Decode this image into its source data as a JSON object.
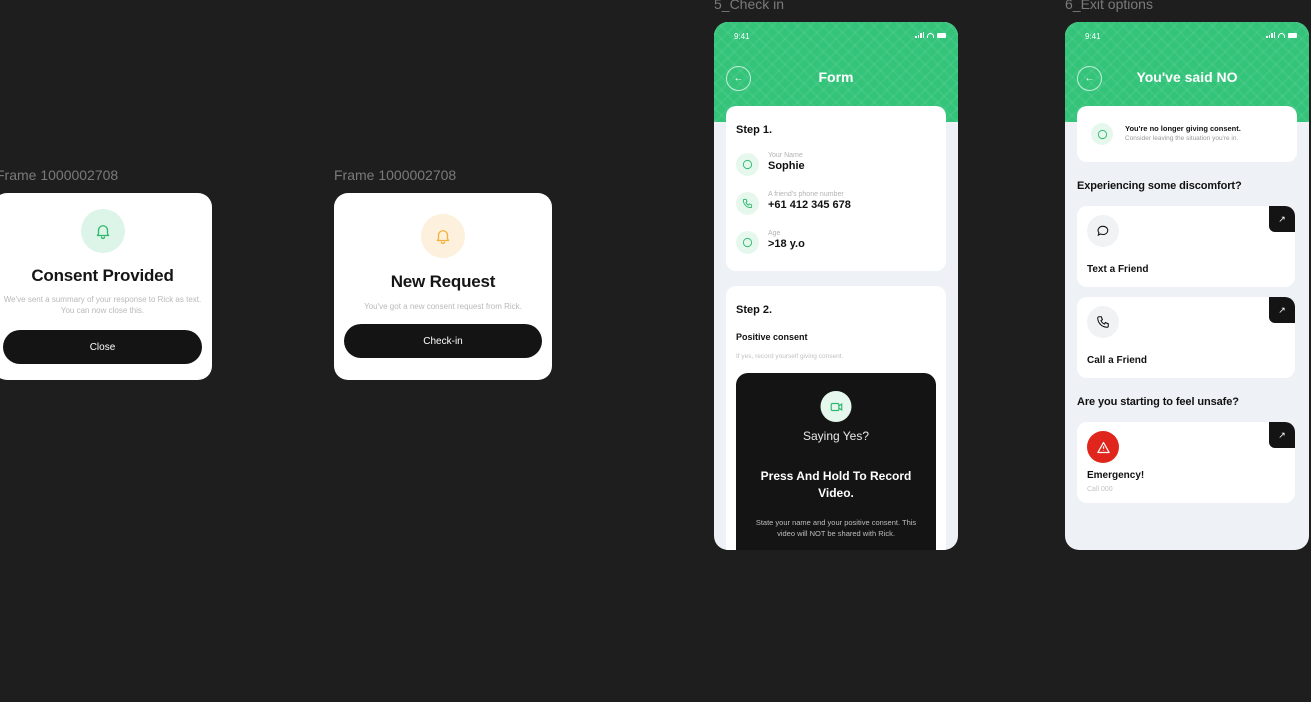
{
  "frames": {
    "consent_label": "Frame 1000002708",
    "request_label": "Frame 1000002708",
    "checkin_label": "5_Check in",
    "exit_label": "6_Exit options"
  },
  "consent_modal": {
    "title": "Consent Provided",
    "description": "We've sent a summary of your response to Rick as text. You can now close this.",
    "button": "Close",
    "icon": "bell-icon",
    "accent": "#dcf5e8"
  },
  "request_modal": {
    "title": "New Request",
    "description": "You've got a new consent request from Rick.",
    "button": "Check-in",
    "icon": "bell-icon",
    "accent": "#fdf0dc"
  },
  "checkin": {
    "status_time": "9:41",
    "title": "Form",
    "step1": {
      "title": "Step 1.",
      "fields": [
        {
          "label": "Your Name",
          "value": "Sophie",
          "icon": "smile-icon"
        },
        {
          "label": "A friend's phone number",
          "value": "+61 412 345 678",
          "icon": "phone-icon"
        },
        {
          "label": "Age",
          "value": ">18 y.o",
          "icon": "smile-icon"
        }
      ]
    },
    "step2": {
      "title": "Step 2.",
      "subtitle": "Positive consent",
      "hint": "If yes, record yourself giving consent.",
      "video": {
        "question": "Saying Yes?",
        "title": "Press And Hold To Record Video.",
        "description": "State your name and your positive consent. This video will NOT be shared with Rick."
      }
    }
  },
  "exit": {
    "status_time": "9:41",
    "title": "You've said NO",
    "notice": {
      "title": "You're no longer giving consent.",
      "subtitle": "Consider leaving the situation you're in."
    },
    "section1": "Experiencing some discomfort?",
    "actions": [
      {
        "label": "Text a Friend",
        "icon": "message-icon"
      },
      {
        "label": "Call a Friend",
        "icon": "phone-icon"
      }
    ],
    "section2": "Are you starting to feel unsafe?",
    "emergency": {
      "label": "Emergency!",
      "sub": "Call 000",
      "icon": "warning-icon",
      "color": "#e0261c"
    }
  },
  "colors": {
    "brand_green": "#33c47a",
    "dark": "#141414",
    "canvas": "#1e1e1e"
  }
}
